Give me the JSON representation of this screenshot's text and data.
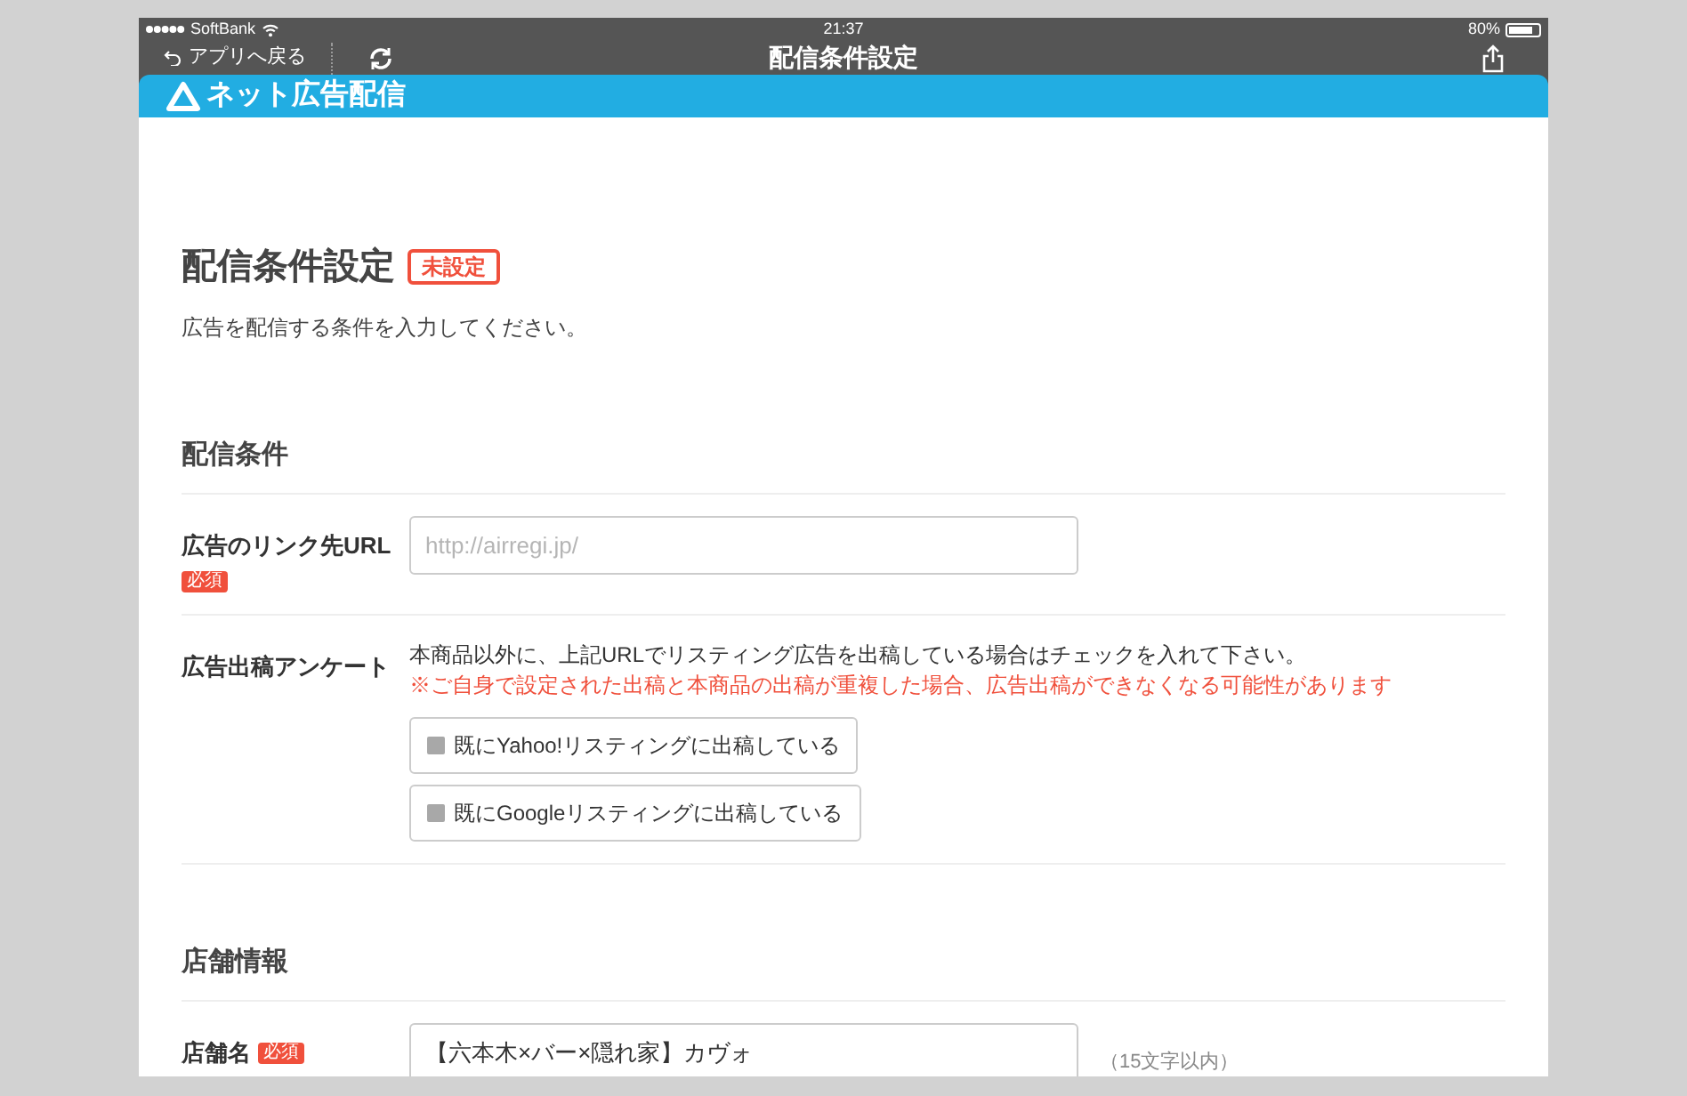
{
  "status_bar": {
    "carrier": "SoftBank",
    "time": "21:37",
    "battery": "80%"
  },
  "nav_bar": {
    "back": "アプリへ戻る",
    "title": "配信条件設定"
  },
  "header": {
    "title": "ネット広告配信"
  },
  "page": {
    "title": "配信条件設定",
    "badge": "未設定",
    "description": "広告を配信する条件を入力してください。"
  },
  "sections": [
    {
      "heading": "配信条件",
      "rows": [
        {
          "kind": "text_input",
          "label": "広告のリンク先URL",
          "required": "必須",
          "placeholder": "http://airregi.jp/"
        },
        {
          "kind": "checkbox_group",
          "label": "広告出稿アンケート",
          "text": "本商品以外に、上記URLでリスティング広告を出稿している場合はチェックを入れて下さい。",
          "warning": "※ご自身で設定された出稿と本商品の出稿が重複した場合、広告出稿ができなくなる可能性があります",
          "options": [
            {
              "label": "既にYahoo!リスティングに出稿している",
              "checked": false
            },
            {
              "label": "既にGoogleリスティングに出稿している",
              "checked": false
            }
          ]
        }
      ]
    },
    {
      "heading": "店舗情報",
      "rows": [
        {
          "kind": "text_input",
          "label": "店舗名",
          "required": "必須",
          "value": "【六本木×バー×隠れ家】カヴォ",
          "note": "（15文字以内）"
        }
      ]
    }
  ]
}
